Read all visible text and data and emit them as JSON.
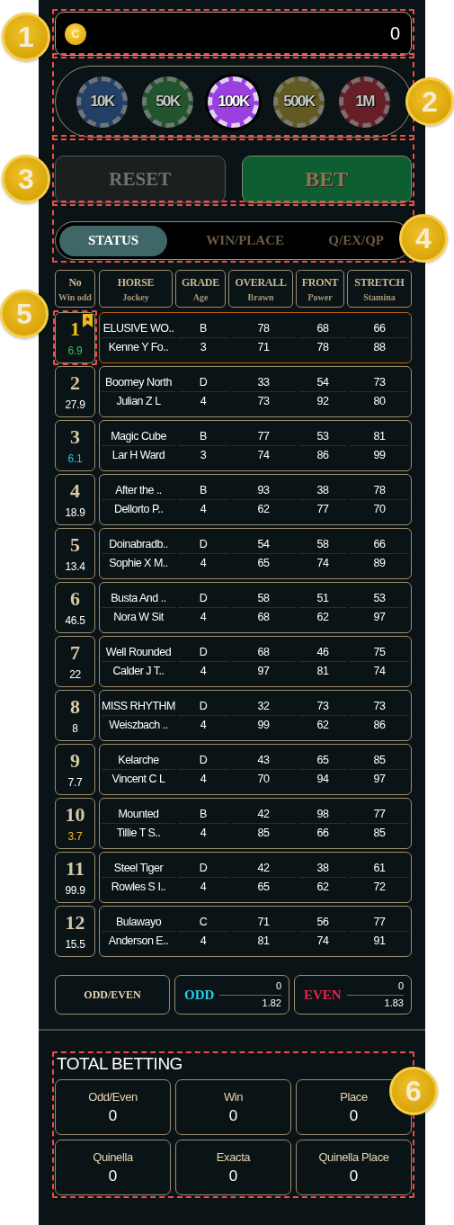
{
  "balance": {
    "coin": "C",
    "amount": "0"
  },
  "chips": [
    {
      "label": "10K",
      "color": "#223f66",
      "selected": false
    },
    {
      "label": "50K",
      "color": "#22552e",
      "selected": false
    },
    {
      "label": "100K",
      "color": "#9b3fe0",
      "selected": true
    },
    {
      "label": "500K",
      "color": "#615a22",
      "selected": false
    },
    {
      "label": "1M",
      "color": "#661f27",
      "selected": false
    }
  ],
  "actions": [
    {
      "label": "RESET",
      "kind": "reset"
    },
    {
      "label": "BET",
      "kind": "bet"
    }
  ],
  "tabs": [
    {
      "label": "STATUS",
      "selected": true
    },
    {
      "label": "WIN/PLACE",
      "selected": false
    },
    {
      "label": "Q/EX/QP",
      "selected": false
    }
  ],
  "table": {
    "columns": [
      {
        "top": "No",
        "bottom": "Win odd"
      },
      {
        "top": "HORSE",
        "bottom": "Jockey"
      },
      {
        "top": "GRADE",
        "bottom": "Age"
      },
      {
        "top": "OVERALL",
        "bottom": "Brawn"
      },
      {
        "top": "FRONT",
        "bottom": "Power"
      },
      {
        "top": "STRETCH",
        "bottom": "Stamina"
      }
    ],
    "rows": [
      {
        "no": "1",
        "odd": "6.9",
        "color": "#2ecc55",
        "selected": true,
        "horse": "ELUSIVE WO..",
        "jockey": "Kenne Y Fo..",
        "grade": "B",
        "age": "3",
        "overall": "78",
        "brawn": "71",
        "front": "68",
        "power": "78",
        "stretch": "66",
        "stamina": "88"
      },
      {
        "no": "2",
        "odd": "27.9",
        "color": "#ffffff",
        "selected": false,
        "horse": "Boomey North",
        "jockey": "Julian Z L",
        "grade": "D",
        "age": "4",
        "overall": "33",
        "brawn": "73",
        "front": "54",
        "power": "92",
        "stretch": "73",
        "stamina": "80"
      },
      {
        "no": "3",
        "odd": "6.1",
        "color": "#1ec8e6",
        "selected": false,
        "horse": "Magic Cube",
        "jockey": "Lar H Ward",
        "grade": "B",
        "age": "3",
        "overall": "77",
        "brawn": "74",
        "front": "53",
        "power": "86",
        "stretch": "81",
        "stamina": "99"
      },
      {
        "no": "4",
        "odd": "18.9",
        "color": "#ffffff",
        "selected": false,
        "horse": "After the ..",
        "jockey": "Dellorto P..",
        "grade": "B",
        "age": "4",
        "overall": "93",
        "brawn": "62",
        "front": "38",
        "power": "77",
        "stretch": "78",
        "stamina": "70"
      },
      {
        "no": "5",
        "odd": "13.4",
        "color": "#ffffff",
        "selected": false,
        "horse": "Doinabradb..",
        "jockey": "Sophie X M..",
        "grade": "D",
        "age": "4",
        "overall": "54",
        "brawn": "65",
        "front": "58",
        "power": "74",
        "stretch": "66",
        "stamina": "89"
      },
      {
        "no": "6",
        "odd": "46.5",
        "color": "#ffffff",
        "selected": false,
        "horse": "Busta And ..",
        "jockey": "Nora W Sit",
        "grade": "D",
        "age": "4",
        "overall": "58",
        "brawn": "68",
        "front": "51",
        "power": "62",
        "stretch": "53",
        "stamina": "97"
      },
      {
        "no": "7",
        "odd": "22",
        "color": "#ffffff",
        "selected": false,
        "horse": "Well Rounded",
        "jockey": "Calder J T..",
        "grade": "D",
        "age": "4",
        "overall": "68",
        "brawn": "97",
        "front": "46",
        "power": "81",
        "stretch": "75",
        "stamina": "74"
      },
      {
        "no": "8",
        "odd": "8",
        "color": "#ffffff",
        "selected": false,
        "horse": "MISS RHYTHM",
        "jockey": "Weiszbach ..",
        "grade": "D",
        "age": "4",
        "overall": "32",
        "brawn": "99",
        "front": "73",
        "power": "62",
        "stretch": "73",
        "stamina": "86"
      },
      {
        "no": "9",
        "odd": "7.7",
        "color": "#ffffff",
        "selected": false,
        "horse": "Kelarche",
        "jockey": "Vincent C L",
        "grade": "D",
        "age": "4",
        "overall": "43",
        "brawn": "70",
        "front": "65",
        "power": "94",
        "stretch": "85",
        "stamina": "97"
      },
      {
        "no": "10",
        "odd": "3.7",
        "color": "#f0c419",
        "selected": false,
        "horse": "Mounted",
        "jockey": "Tillie T S..",
        "grade": "B",
        "age": "4",
        "overall": "42",
        "brawn": "85",
        "front": "98",
        "power": "66",
        "stretch": "77",
        "stamina": "85"
      },
      {
        "no": "11",
        "odd": "99.9",
        "color": "#ffffff",
        "selected": false,
        "horse": "Steel Tiger",
        "jockey": "Rowles S I..",
        "grade": "D",
        "age": "4",
        "overall": "42",
        "brawn": "65",
        "front": "38",
        "power": "62",
        "stretch": "61",
        "stamina": "72"
      },
      {
        "no": "12",
        "odd": "15.5",
        "color": "#ffffff",
        "selected": false,
        "horse": "Bulawayo",
        "jockey": "Anderson E..",
        "grade": "C",
        "age": "4",
        "overall": "71",
        "brawn": "81",
        "front": "56",
        "power": "74",
        "stretch": "77",
        "stamina": "91"
      }
    ]
  },
  "odd_even": {
    "label": "ODD/EVEN",
    "options": [
      {
        "label": "ODD",
        "amount": "0",
        "odds": "1.82",
        "color": "#22d3ee"
      },
      {
        "label": "EVEN",
        "amount": "0",
        "odds": "1.83",
        "color": "#e8234a"
      }
    ]
  },
  "total_betting": {
    "title": "TOTAL BETTING",
    "items": [
      {
        "label": "Odd/Even",
        "value": "0"
      },
      {
        "label": "Win",
        "value": "0"
      },
      {
        "label": "Place",
        "value": "0"
      },
      {
        "label": "Quinella",
        "value": "0"
      },
      {
        "label": "Exacta",
        "value": "0"
      },
      {
        "label": "Quinella Place",
        "value": "0"
      }
    ]
  },
  "callouts": [
    "1",
    "2",
    "3",
    "4",
    "5",
    "6"
  ]
}
